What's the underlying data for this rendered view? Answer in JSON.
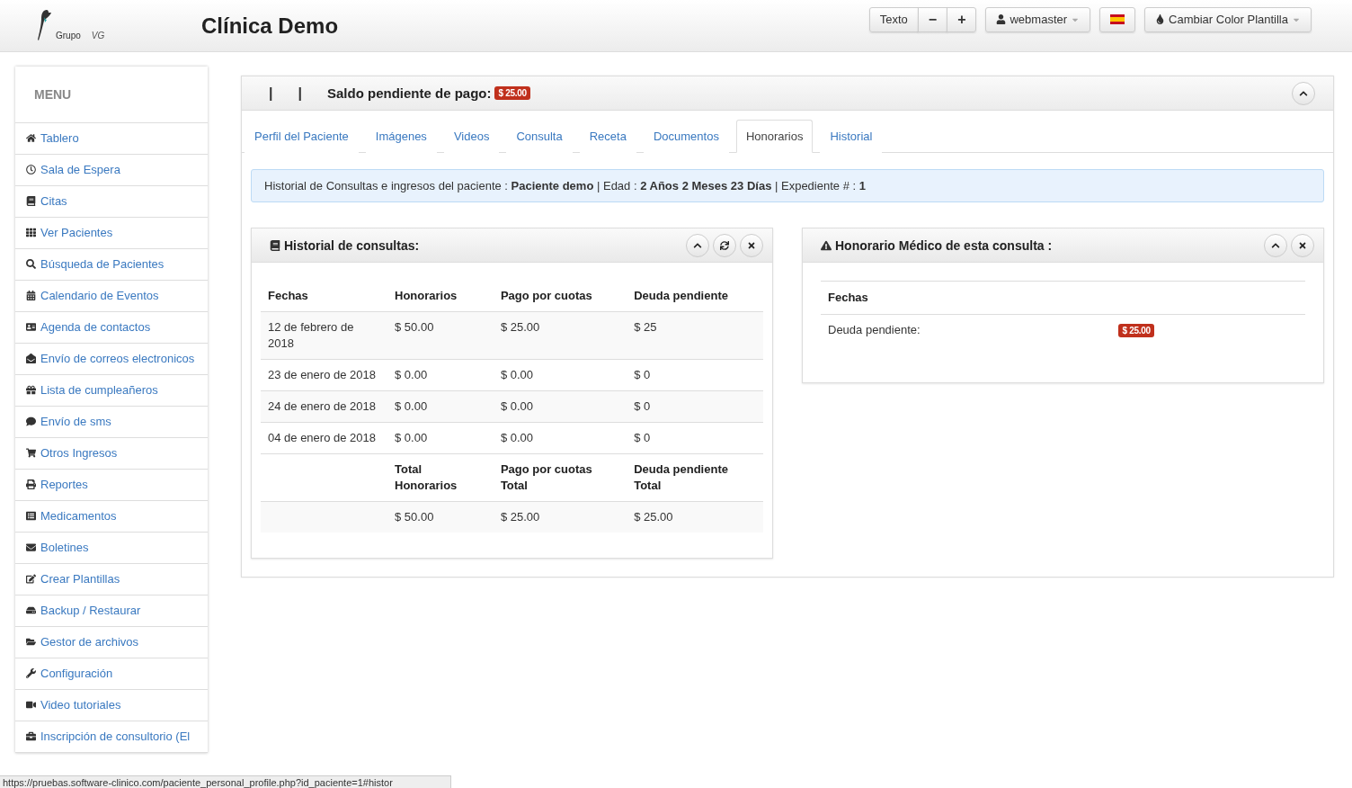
{
  "header": {
    "logo_text": "Grupo",
    "logo_suffix": "VG",
    "title": "Clínica Demo",
    "text_size": {
      "label": "Texto",
      "decrease": "−",
      "increase": "+"
    },
    "user": "webmaster",
    "color_button": "Cambiar Color Plantilla"
  },
  "sidebar": {
    "title": "MENU",
    "items": [
      {
        "label": "Tablero"
      },
      {
        "label": "Sala de Espera"
      },
      {
        "label": "Citas"
      },
      {
        "label": "Ver Pacientes"
      },
      {
        "label": "Búsqueda de Pacientes"
      },
      {
        "label": "Calendario de Eventos"
      },
      {
        "label": "Agenda de contactos"
      },
      {
        "label": "Envío de correos electronicos"
      },
      {
        "label": "Lista de cumpleañeros"
      },
      {
        "label": "Envío de sms"
      },
      {
        "label": "Otros Ingresos"
      },
      {
        "label": "Reportes"
      },
      {
        "label": "Medicamentos"
      },
      {
        "label": "Boletines"
      },
      {
        "label": "Crear Plantillas"
      },
      {
        "label": "Backup / Restaurar"
      },
      {
        "label": "Gestor de archivos"
      },
      {
        "label": "Configuración"
      },
      {
        "label": "Video tutoriales"
      },
      {
        "label": "Inscripción de consultorio (El"
      }
    ]
  },
  "panel": {
    "separators": [
      "|",
      "|"
    ],
    "title": "Saldo pendiente de pago:",
    "balance": "$ 25.00",
    "tabs": [
      {
        "label": "Perfil del Paciente",
        "selected": false
      },
      {
        "label": "Imágenes",
        "selected": false
      },
      {
        "label": "Videos",
        "selected": false
      },
      {
        "label": "Consulta",
        "selected": false
      },
      {
        "label": "Receta",
        "selected": false
      },
      {
        "label": "Documentos",
        "selected": false
      },
      {
        "label": "Honorarios",
        "selected": true
      },
      {
        "label": "Historial",
        "selected": false
      }
    ],
    "info": "Historial de Consultas e ingresos del paciente : **Paciente demo** | Edad : **2 Años 2 Meses 23 Días** | Expediente # : **1**"
  },
  "history": {
    "title": "Historial de consultas:",
    "columns": [
      "Fechas",
      "Honorarios",
      "Pago por cuotas",
      "Deuda pendiente"
    ],
    "rows": [
      [
        "12 de febrero de 2018",
        "$ 50.00",
        "$ 25.00",
        "$ 25"
      ],
      [
        "23 de enero de 2018",
        "$ 0.00",
        "$ 0.00",
        "$ 0"
      ],
      [
        "24 de enero de 2018",
        "$ 0.00",
        "$ 0.00",
        "$ 0"
      ],
      [
        "04 de enero de 2018",
        "$ 0.00",
        "$ 0.00",
        "$ 0"
      ]
    ],
    "total_headers": [
      "Total Honorarios",
      "Pago por cuotas Total",
      "Deuda pendiente Total"
    ],
    "totals": [
      "$ 50.00",
      "$ 25.00",
      "$ 25.00"
    ]
  },
  "fee": {
    "title": "Honorario Médico de esta consulta :",
    "heading": "Fechas",
    "label": "Deuda pendiente:",
    "amount": "$ 25.00"
  },
  "status_bar": "https://pruebas.software-clinico.com/paciente_personal_profile.php?id_paciente=1#histor"
}
